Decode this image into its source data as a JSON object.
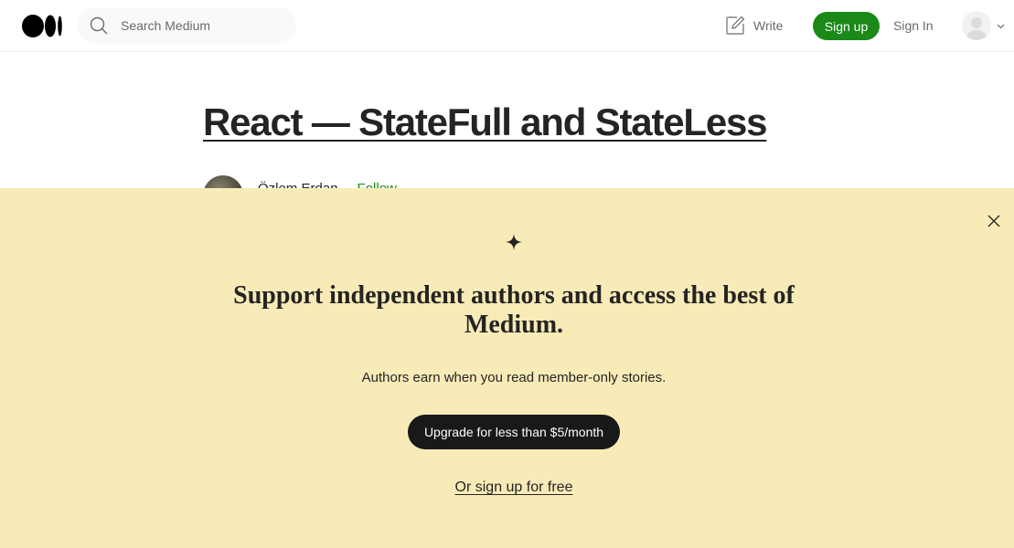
{
  "header": {
    "search_placeholder": "Search Medium",
    "write_label": "Write",
    "signup_label": "Sign up",
    "signin_label": "Sign In"
  },
  "article": {
    "title": "React — StateFull and StateLess",
    "author": "Özlem Erdan",
    "separator": "·",
    "follow_label": "Follow"
  },
  "paywall": {
    "headline": "Support independent authors and access the best of Medium.",
    "subtext": "Authors earn when you read member-only stories.",
    "upgrade_label": "Upgrade for less than $5/month",
    "free_label": "Or sign up for free"
  },
  "colors": {
    "accent_green": "#1a8917",
    "overlay_background": "#f9ebb7",
    "dark_button": "#191919"
  },
  "icons": [
    "medium-logo-icon",
    "search-icon",
    "write-icon",
    "user-avatar-icon",
    "chevron-down-icon",
    "close-icon",
    "sparkle-star-icon"
  ]
}
